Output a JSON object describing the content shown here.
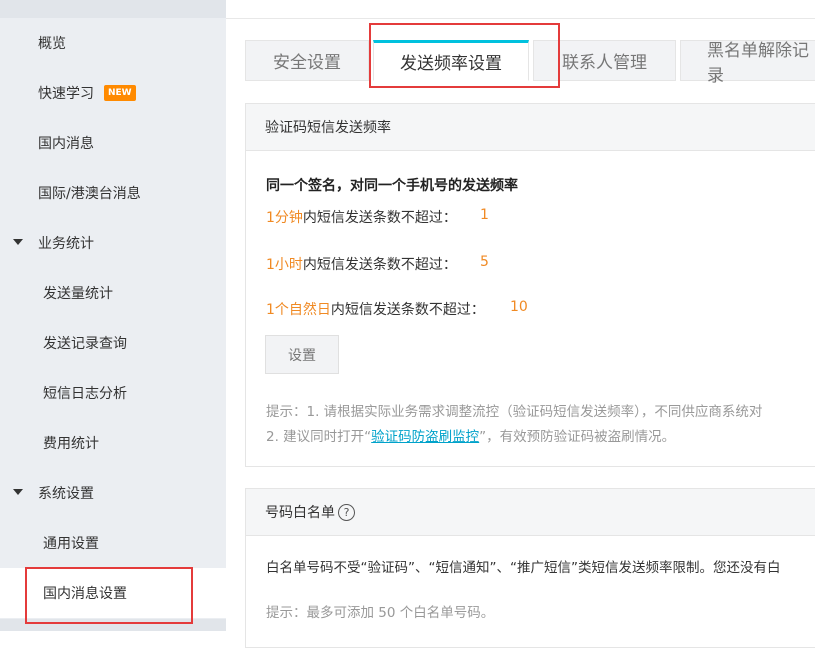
{
  "sidebar": {
    "items": [
      {
        "label": "概览"
      },
      {
        "label": "快速学习",
        "badge": "NEW"
      },
      {
        "label": "国内消息"
      },
      {
        "label": "国际/港澳台消息"
      },
      {
        "label": "业务统计"
      },
      {
        "label": "发送量统计"
      },
      {
        "label": "发送记录查询"
      },
      {
        "label": "短信日志分析"
      },
      {
        "label": "费用统计"
      },
      {
        "label": "系统设置"
      },
      {
        "label": "通用设置"
      },
      {
        "label": "国内消息设置"
      }
    ]
  },
  "tabs": [
    {
      "label": "安全设置"
    },
    {
      "label": "发送频率设置"
    },
    {
      "label": "联系人管理"
    },
    {
      "label": "黑名单解除记录"
    }
  ],
  "freq_panel": {
    "title": "验证码短信发送频率",
    "heading": "同一个签名，对同一个手机号的发送频率",
    "rows": [
      {
        "period": "1分钟",
        "text": "内短信发送条数不超过：",
        "value": "1"
      },
      {
        "period": "1小时",
        "text": "内短信发送条数不超过：",
        "value": "5"
      },
      {
        "period": "1个自然日",
        "text": "内短信发送条数不超过：",
        "value": "10"
      }
    ],
    "button": "设置",
    "tip1": "提示：1. 请根据实际业务需求调整流控（验证码短信发送频率），不同供应商系统对",
    "tip2_prefix": "2. 建议同时打开“",
    "tip2_link": "验证码防盗刷监控",
    "tip2_suffix": "”，有效预防验证码被盗刷情况。"
  },
  "whitelist_panel": {
    "title": "号码白名单",
    "help_icon": "?",
    "desc": "白名单号码不受“验证码”、“短信通知”、“推广短信”类短信发送频率限制。您还没有白",
    "tip": "提示：最多可添加 50 个白名单号码。"
  },
  "colors": {
    "accent": "#00c1de",
    "orange": "#f08a24",
    "highlight_red": "#e43b3b",
    "link": "#00a2ca"
  }
}
